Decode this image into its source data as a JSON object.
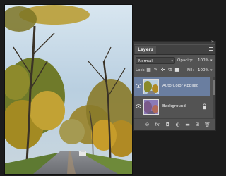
{
  "document": {
    "image_description_icon": "photo-canvas"
  },
  "layers_panel": {
    "tab_label": "Layers",
    "blend_mode": "Normal",
    "opacity_label": "Opacity:",
    "opacity_value": "100%",
    "lock_label": "Lock:",
    "fill_label": "Fill:",
    "fill_value": "100%",
    "lock_icons": [
      "lock-transparent-pixels-icon",
      "lock-image-pixels-icon",
      "lock-position-icon",
      "lock-artboard-icon",
      "lock-all-icon"
    ],
    "layers": [
      {
        "name": "Auto Color Applied",
        "selected": true,
        "visible": true,
        "locked": false
      },
      {
        "name": "Background",
        "selected": false,
        "visible": true,
        "locked": true
      }
    ],
    "bottom_icons": [
      "link-layers-icon",
      "fx-icon",
      "layer-mask-icon",
      "adjustment-layer-icon",
      "new-group-icon",
      "new-layer-icon",
      "delete-layer-icon"
    ],
    "fx_glyph": "fx",
    "colors": {
      "panel_bg": "#535353",
      "selected_row": "#6a7ea0",
      "app_bg": "#1c1c1c"
    }
  }
}
